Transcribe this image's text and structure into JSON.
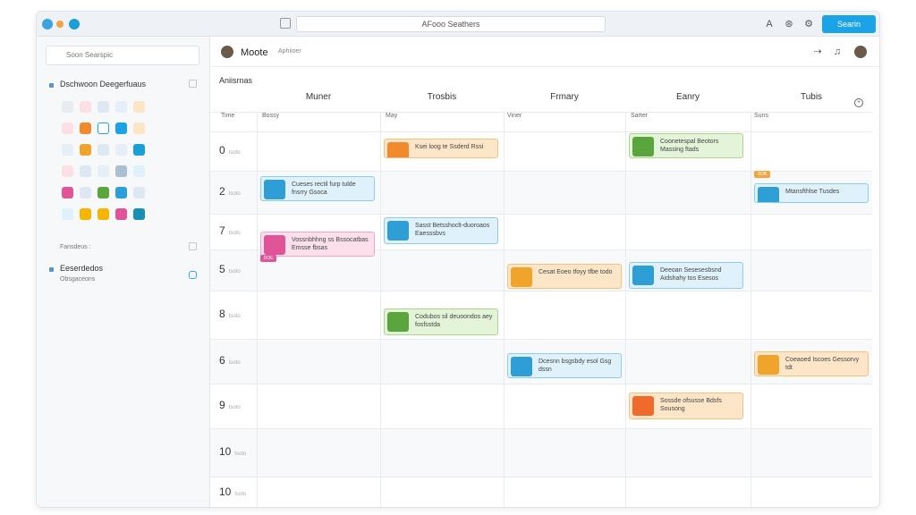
{
  "titlebar": {
    "address": "AFooo Seathers",
    "action_button": "Searin",
    "icons": [
      "font-icon",
      "globe-icon",
      "settings-icon"
    ]
  },
  "sidebar": {
    "search_placeholder": "Soon Searspic",
    "section1_title": "Dschwoon Deegerfuaus",
    "section_footer": "Fansdeus :",
    "section2_title": "Eeserdedos",
    "section2_sub": "Obsgaceons"
  },
  "main": {
    "title": "Moote",
    "tag": "Aphiioer",
    "corner_label": "Aniisrnas",
    "columns": [
      "Muner",
      "Trosbis",
      "Frmary",
      "Eanry",
      "Tubis"
    ],
    "sub_headers": [
      "Time",
      "Bossy",
      "May",
      "Viner",
      "Sarter",
      "Suns"
    ],
    "hours": [
      {
        "value": "0",
        "suffix": "tsoto"
      },
      {
        "value": "2",
        "suffix": "tsoto"
      },
      {
        "value": "7",
        "suffix": "tsoto"
      },
      {
        "value": "5",
        "suffix": "tsoto"
      },
      {
        "value": "8",
        "suffix": "tsoto"
      },
      {
        "value": "6",
        "suffix": "tsoto"
      },
      {
        "value": "9",
        "suffix": "tsoto"
      },
      {
        "value": "10",
        "suffix": "tsoto"
      },
      {
        "value": "10",
        "suffix": "tsoto"
      }
    ]
  },
  "events": [
    {
      "text": "Ksei loog te Ssderd Rssi",
      "color": "#fde6c8",
      "border": "#f4c17d",
      "icon": "#f08a2c"
    },
    {
      "text": "Coonetespal Beotors Massing ftads",
      "color": "#e3f4d8",
      "border": "#a8d88c",
      "icon": "#5aa63c"
    },
    {
      "text": "Cueses rectil furp tulde fnsrry Gsoca",
      "color": "#dff1fa",
      "border": "#8fcbea",
      "icon": "#2e9fd6"
    },
    {
      "text": "Mtansfthlse Tusdes",
      "color": "#dff1fa",
      "border": "#8fcbea",
      "icon": "#2e9fd6"
    },
    {
      "text": "Sasst Betsshoclt-duoroaos Eaesssbvs",
      "color": "#dff1fa",
      "border": "#8fcbea",
      "icon": "#2e9fd6"
    },
    {
      "text": "Vossnbhhng ss Bssocatbas Emsse fbsas",
      "color": "#fbe0ec",
      "border": "#f0a5c6",
      "icon": "#e0559a"
    },
    {
      "text": "Cesat Eoeo tfoyy tfbe todo",
      "color": "#fde6c8",
      "border": "#f4c17d",
      "icon": "#f0a42c"
    },
    {
      "text": "Deeoan Sesesesbsnd Aidshahy tos Esesos",
      "color": "#dff1fa",
      "border": "#8fcbea",
      "icon": "#2e9fd6"
    },
    {
      "text": "Codubos sil deuoondos aey fosfsstda",
      "color": "#e3f4d8",
      "border": "#a8d88c",
      "icon": "#5aa63c"
    },
    {
      "text": "Coeaoed Iscoes Gessorvy tdt",
      "color": "#fde6c8",
      "border": "#f4c17d",
      "icon": "#f0a42c"
    },
    {
      "text": "Dcesnn bsgsbdy esol Gsg dssn",
      "color": "#dff1fa",
      "border": "#8fcbea",
      "icon": "#2e9fd6"
    },
    {
      "text": "Sossde ofsusse Bdsfs Sousong",
      "color": "#fde6c8",
      "border": "#f4c17d",
      "icon": "#f06a2c"
    }
  ],
  "badges": [
    {
      "label": "DOE",
      "color": "#e0559a"
    },
    {
      "label": "SDB",
      "color": "#f4a43c"
    }
  ]
}
